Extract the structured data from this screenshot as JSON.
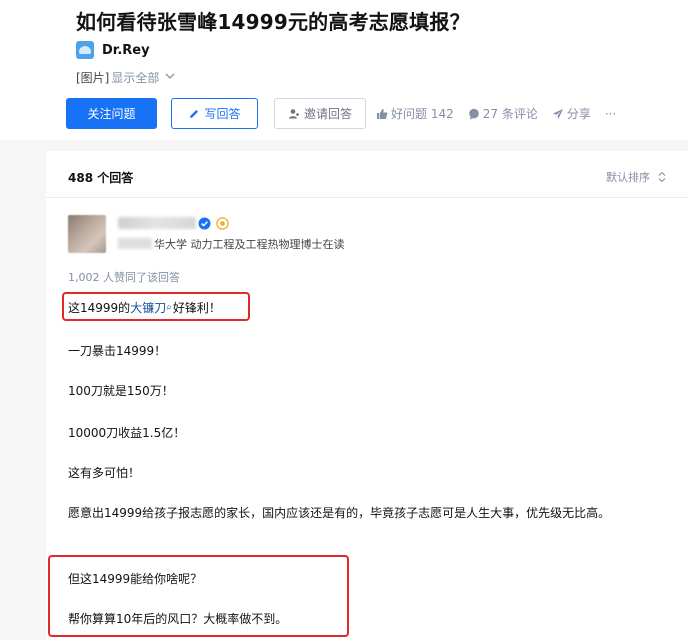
{
  "question": {
    "title": "如何看待张雪峰14999元的高考志愿填报？",
    "asker_name": "Dr.Rey",
    "image_tag": "[图片]",
    "show_all": "显示全部"
  },
  "actions": {
    "follow_label": "关注问题",
    "write_label": "写回答",
    "invite_label": "邀请回答",
    "good_question_label": "好问题 142",
    "comments_label": "27 条评论",
    "share_label": "分享",
    "more_label": "···"
  },
  "answers": {
    "count_label": "488 个回答",
    "sort_label": "默认排序"
  },
  "answer": {
    "author_bio": "华大学 动力工程及工程热物理博士在读",
    "upvote_info": "1,002 人赞同了该回答",
    "first_line": {
      "prefix": "这14999的",
      "keyword": "大镰刀",
      "suffix": "好锋利！"
    },
    "paragraphs": [
      "一刀暴击14999！",
      "100刀就是150万！",
      "10000刀收益1.5亿！",
      "这有多可怕！",
      "愿意出14999给孩子报志愿的家长，国内应该还是有的，毕竟孩子志愿可是人生大事，优先级无比高。",
      "但这14999能给你啥呢？",
      "帮你算算10年后的风口？大概率做不到。"
    ]
  },
  "colors": {
    "brand_blue": "#1772f6",
    "highlight_red": "#e02a2a",
    "meta_gray": "#8590a6"
  }
}
